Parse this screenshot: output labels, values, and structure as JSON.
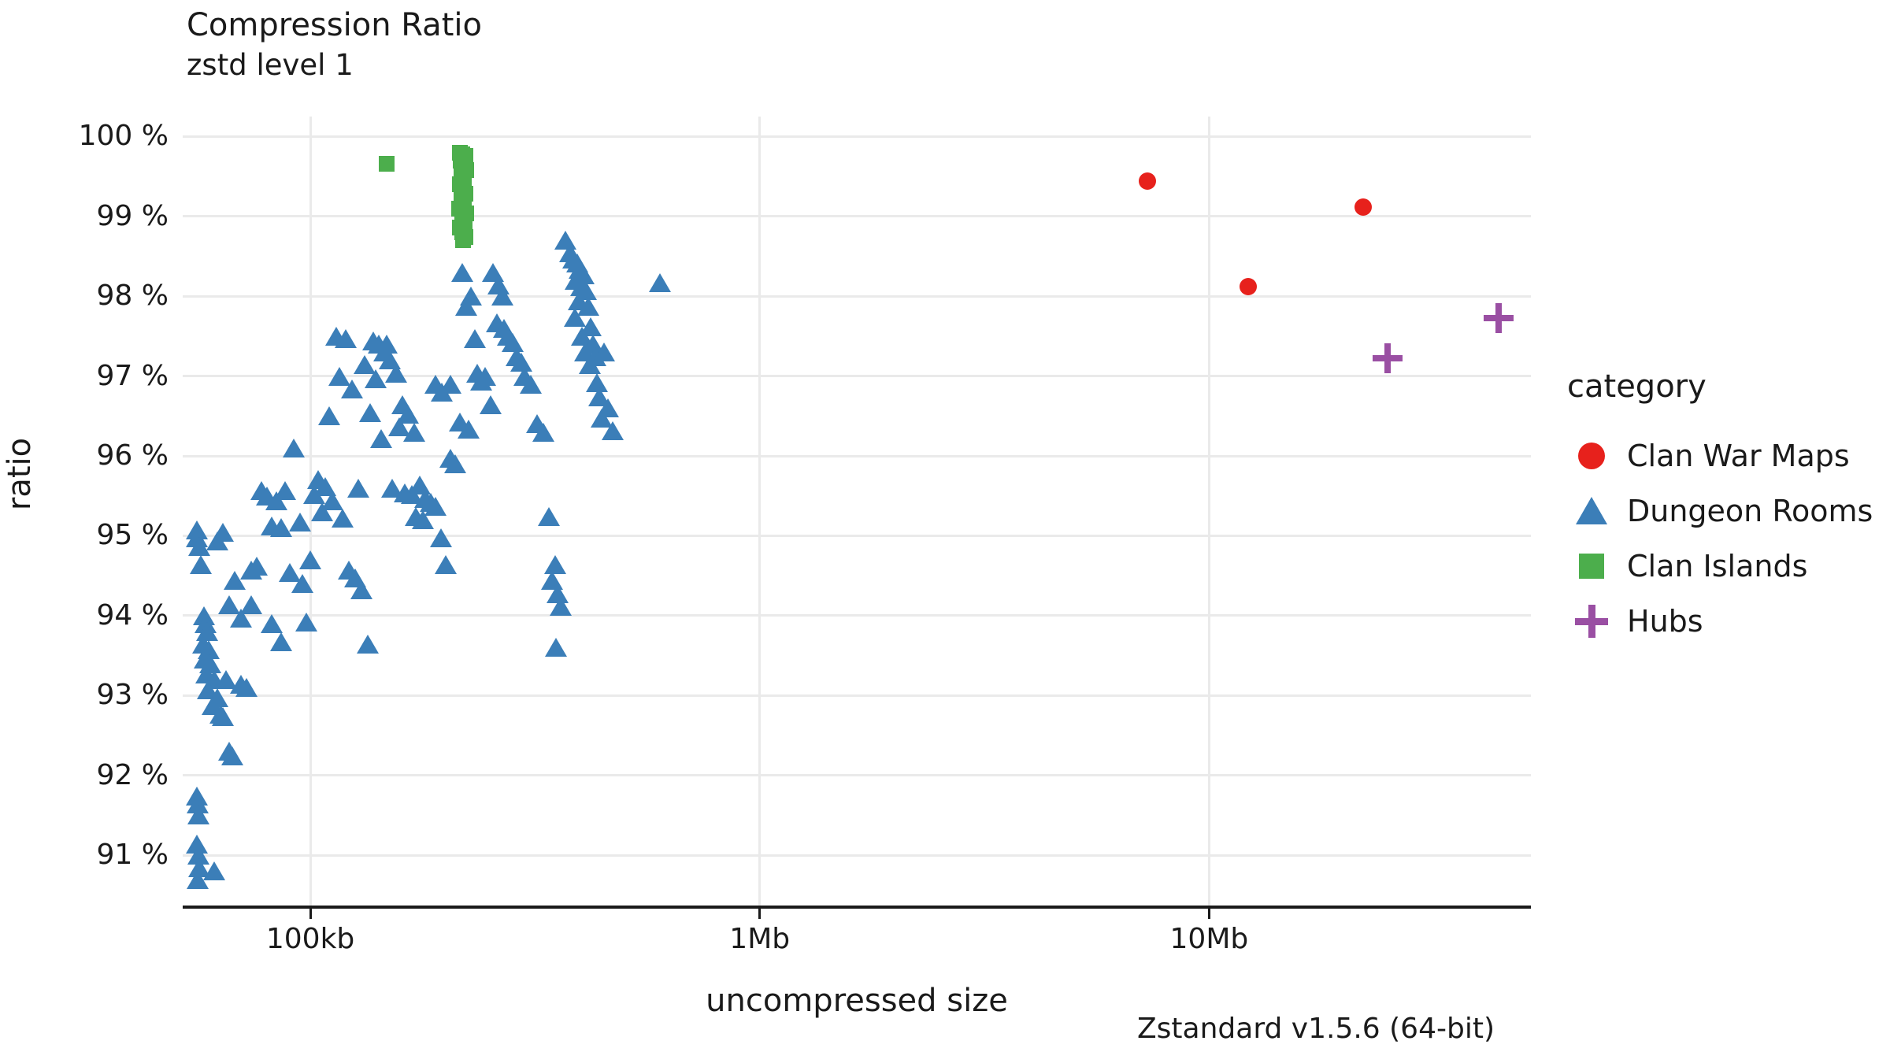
{
  "chart_data": {
    "type": "scatter",
    "title": "Compression Ratio",
    "subtitle": "zstd level 1",
    "xlabel": "uncompressed size",
    "ylabel": "ratio",
    "footer": "Zstandard v1.5.6 (64-bit)",
    "x_scale": "log",
    "x_tick_labels": [
      "100kb",
      "1Mb",
      "10Mb"
    ],
    "x_tick_values": [
      100000,
      1000000,
      10000000
    ],
    "xlim": [
      52000,
      52000000
    ],
    "y_tick_labels": [
      "100 %",
      "99 %",
      "98 %",
      "97 %",
      "96 %",
      "95 %",
      "94 %",
      "93 %",
      "92 %",
      "91 %"
    ],
    "y_tick_values": [
      100,
      99,
      98,
      97,
      96,
      95,
      94,
      93,
      92,
      91
    ],
    "ylim": [
      90.35,
      100.25
    ],
    "grid": "both-light",
    "legend_position": "right",
    "legend_title": "category",
    "series": [
      {
        "name": "Clan War Maps",
        "marker": "circle",
        "color": "#e7211c",
        "points": [
          {
            "x": 7300000,
            "y": 99.44
          },
          {
            "x": 12200000,
            "y": 98.12
          },
          {
            "x": 22000000,
            "y": 99.12
          }
        ]
      },
      {
        "name": "Dungeon Rooms",
        "marker": "triangle",
        "color": "#3b7eb8",
        "points": [
          {
            "x": 56000,
            "y": 95.05
          },
          {
            "x": 56000,
            "y": 94.95
          },
          {
            "x": 56500,
            "y": 94.85
          },
          {
            "x": 57000,
            "y": 94.62
          },
          {
            "x": 56000,
            "y": 91.72
          },
          {
            "x": 56200,
            "y": 91.62
          },
          {
            "x": 56400,
            "y": 91.48
          },
          {
            "x": 56000,
            "y": 91.12
          },
          {
            "x": 56300,
            "y": 90.98
          },
          {
            "x": 56500,
            "y": 90.82
          },
          {
            "x": 56200,
            "y": 90.68
          },
          {
            "x": 61000,
            "y": 90.78
          },
          {
            "x": 58000,
            "y": 93.98
          },
          {
            "x": 58500,
            "y": 93.88
          },
          {
            "x": 59000,
            "y": 93.78
          },
          {
            "x": 57800,
            "y": 93.62
          },
          {
            "x": 59500,
            "y": 93.55
          },
          {
            "x": 58200,
            "y": 93.44
          },
          {
            "x": 60000,
            "y": 93.38
          },
          {
            "x": 58800,
            "y": 93.25
          },
          {
            "x": 61000,
            "y": 93.18
          },
          {
            "x": 59200,
            "y": 93.05
          },
          {
            "x": 62000,
            "y": 92.95
          },
          {
            "x": 60500,
            "y": 92.85
          },
          {
            "x": 63000,
            "y": 92.75
          },
          {
            "x": 64000,
            "y": 92.72
          },
          {
            "x": 66000,
            "y": 92.28
          },
          {
            "x": 67000,
            "y": 92.22
          },
          {
            "x": 65000,
            "y": 93.18
          },
          {
            "x": 70000,
            "y": 93.12
          },
          {
            "x": 72000,
            "y": 93.08
          },
          {
            "x": 74000,
            "y": 94.55
          },
          {
            "x": 76000,
            "y": 94.6
          },
          {
            "x": 68000,
            "y": 94.42
          },
          {
            "x": 70000,
            "y": 93.95
          },
          {
            "x": 66000,
            "y": 94.12
          },
          {
            "x": 80000,
            "y": 95.48
          },
          {
            "x": 84000,
            "y": 95.42
          },
          {
            "x": 88000,
            "y": 95.55
          },
          {
            "x": 92000,
            "y": 96.08
          },
          {
            "x": 86000,
            "y": 95.08
          },
          {
            "x": 95000,
            "y": 95.15
          },
          {
            "x": 98000,
            "y": 93.9
          },
          {
            "x": 90000,
            "y": 94.52
          },
          {
            "x": 102000,
            "y": 95.5
          },
          {
            "x": 108000,
            "y": 95.6
          },
          {
            "x": 112000,
            "y": 95.42
          },
          {
            "x": 106000,
            "y": 95.28
          },
          {
            "x": 118000,
            "y": 95.2
          },
          {
            "x": 122000,
            "y": 94.55
          },
          {
            "x": 126000,
            "y": 94.45
          },
          {
            "x": 130000,
            "y": 94.3
          },
          {
            "x": 134000,
            "y": 93.62
          },
          {
            "x": 124000,
            "y": 96.82
          },
          {
            "x": 132000,
            "y": 97.12
          },
          {
            "x": 138000,
            "y": 97.42
          },
          {
            "x": 142000,
            "y": 97.38
          },
          {
            "x": 146000,
            "y": 97.28
          },
          {
            "x": 150000,
            "y": 97.18
          },
          {
            "x": 140000,
            "y": 96.95
          },
          {
            "x": 155000,
            "y": 97.02
          },
          {
            "x": 160000,
            "y": 96.62
          },
          {
            "x": 165000,
            "y": 96.5
          },
          {
            "x": 158000,
            "y": 96.35
          },
          {
            "x": 170000,
            "y": 96.28
          },
          {
            "x": 175000,
            "y": 95.62
          },
          {
            "x": 168000,
            "y": 95.5
          },
          {
            "x": 180000,
            "y": 95.45
          },
          {
            "x": 185000,
            "y": 95.4
          },
          {
            "x": 190000,
            "y": 95.35
          },
          {
            "x": 178000,
            "y": 95.18
          },
          {
            "x": 195000,
            "y": 94.95
          },
          {
            "x": 200000,
            "y": 94.62
          },
          {
            "x": 210000,
            "y": 95.88
          },
          {
            "x": 205000,
            "y": 95.95
          },
          {
            "x": 215000,
            "y": 96.4
          },
          {
            "x": 225000,
            "y": 96.32
          },
          {
            "x": 235000,
            "y": 97.02
          },
          {
            "x": 245000,
            "y": 96.98
          },
          {
            "x": 255000,
            "y": 98.28
          },
          {
            "x": 262000,
            "y": 98.12
          },
          {
            "x": 268000,
            "y": 97.98
          },
          {
            "x": 275000,
            "y": 97.48
          },
          {
            "x": 282000,
            "y": 97.4
          },
          {
            "x": 288000,
            "y": 97.22
          },
          {
            "x": 295000,
            "y": 97.15
          },
          {
            "x": 300000,
            "y": 96.98
          },
          {
            "x": 310000,
            "y": 96.88
          },
          {
            "x": 320000,
            "y": 96.38
          },
          {
            "x": 330000,
            "y": 96.28
          },
          {
            "x": 340000,
            "y": 95.22
          },
          {
            "x": 350000,
            "y": 94.62
          },
          {
            "x": 345000,
            "y": 94.42
          },
          {
            "x": 355000,
            "y": 94.25
          },
          {
            "x": 360000,
            "y": 94.1
          },
          {
            "x": 352000,
            "y": 93.58
          },
          {
            "x": 370000,
            "y": 98.68
          },
          {
            "x": 378000,
            "y": 98.52
          },
          {
            "x": 385000,
            "y": 98.45
          },
          {
            "x": 392000,
            "y": 98.4
          },
          {
            "x": 398000,
            "y": 98.32
          },
          {
            "x": 405000,
            "y": 98.25
          },
          {
            "x": 390000,
            "y": 98.18
          },
          {
            "x": 400000,
            "y": 98.1
          },
          {
            "x": 410000,
            "y": 98.05
          },
          {
            "x": 396000,
            "y": 97.92
          },
          {
            "x": 415000,
            "y": 97.85
          },
          {
            "x": 388000,
            "y": 97.72
          },
          {
            "x": 420000,
            "y": 97.6
          },
          {
            "x": 402000,
            "y": 97.48
          },
          {
            "x": 425000,
            "y": 97.38
          },
          {
            "x": 408000,
            "y": 97.28
          },
          {
            "x": 430000,
            "y": 97.22
          },
          {
            "x": 418000,
            "y": 97.12
          },
          {
            "x": 435000,
            "y": 96.9
          },
          {
            "x": 440000,
            "y": 96.72
          },
          {
            "x": 445000,
            "y": 96.45
          },
          {
            "x": 450000,
            "y": 97.28
          },
          {
            "x": 460000,
            "y": 96.58
          },
          {
            "x": 470000,
            "y": 96.3
          },
          {
            "x": 240000,
            "y": 96.92
          },
          {
            "x": 232000,
            "y": 97.45
          },
          {
            "x": 252000,
            "y": 96.62
          },
          {
            "x": 222000,
            "y": 97.85
          },
          {
            "x": 218000,
            "y": 98.28
          },
          {
            "x": 228000,
            "y": 97.98
          },
          {
            "x": 600000,
            "y": 98.15
          },
          {
            "x": 148000,
            "y": 97.38
          },
          {
            "x": 144000,
            "y": 96.2
          },
          {
            "x": 136000,
            "y": 96.52
          },
          {
            "x": 116000,
            "y": 96.98
          },
          {
            "x": 110000,
            "y": 96.48
          },
          {
            "x": 104000,
            "y": 95.68
          },
          {
            "x": 100000,
            "y": 94.68
          },
          {
            "x": 96000,
            "y": 94.38
          },
          {
            "x": 128000,
            "y": 95.58
          },
          {
            "x": 152000,
            "y": 95.58
          },
          {
            "x": 162000,
            "y": 95.52
          },
          {
            "x": 172000,
            "y": 95.22
          },
          {
            "x": 114000,
            "y": 97.48
          },
          {
            "x": 120000,
            "y": 97.45
          },
          {
            "x": 78000,
            "y": 95.55
          },
          {
            "x": 82000,
            "y": 95.1
          },
          {
            "x": 74000,
            "y": 94.12
          },
          {
            "x": 82000,
            "y": 93.88
          },
          {
            "x": 86000,
            "y": 93.65
          },
          {
            "x": 64000,
            "y": 95.02
          },
          {
            "x": 62000,
            "y": 94.92
          },
          {
            "x": 190000,
            "y": 96.88
          },
          {
            "x": 196000,
            "y": 96.78
          },
          {
            "x": 205000,
            "y": 96.88
          },
          {
            "x": 260000,
            "y": 97.65
          },
          {
            "x": 270000,
            "y": 97.58
          }
        ]
      },
      {
        "name": "Clan Islands",
        "marker": "square",
        "color": "#4cae4c",
        "points": [
          {
            "x": 148000,
            "y": 99.66
          },
          {
            "x": 215000,
            "y": 99.8
          },
          {
            "x": 218000,
            "y": 99.78
          },
          {
            "x": 221000,
            "y": 99.76
          },
          {
            "x": 216000,
            "y": 99.7
          },
          {
            "x": 219000,
            "y": 99.64
          },
          {
            "x": 222000,
            "y": 99.58
          },
          {
            "x": 217000,
            "y": 99.52
          },
          {
            "x": 220000,
            "y": 99.46
          },
          {
            "x": 215500,
            "y": 99.4
          },
          {
            "x": 218500,
            "y": 99.34
          },
          {
            "x": 221500,
            "y": 99.28
          },
          {
            "x": 216500,
            "y": 99.22
          },
          {
            "x": 219500,
            "y": 99.16
          },
          {
            "x": 214500,
            "y": 99.1
          },
          {
            "x": 222500,
            "y": 99.04
          },
          {
            "x": 217500,
            "y": 98.98
          },
          {
            "x": 220500,
            "y": 98.92
          },
          {
            "x": 215000,
            "y": 98.86
          },
          {
            "x": 218000,
            "y": 98.8
          },
          {
            "x": 221000,
            "y": 98.74
          },
          {
            "x": 219000,
            "y": 98.7
          }
        ]
      },
      {
        "name": "Hubs",
        "marker": "cross",
        "color": "#9a4fa3",
        "points": [
          {
            "x": 25000000,
            "y": 97.22
          },
          {
            "x": 44000000,
            "y": 97.73
          }
        ]
      }
    ]
  }
}
